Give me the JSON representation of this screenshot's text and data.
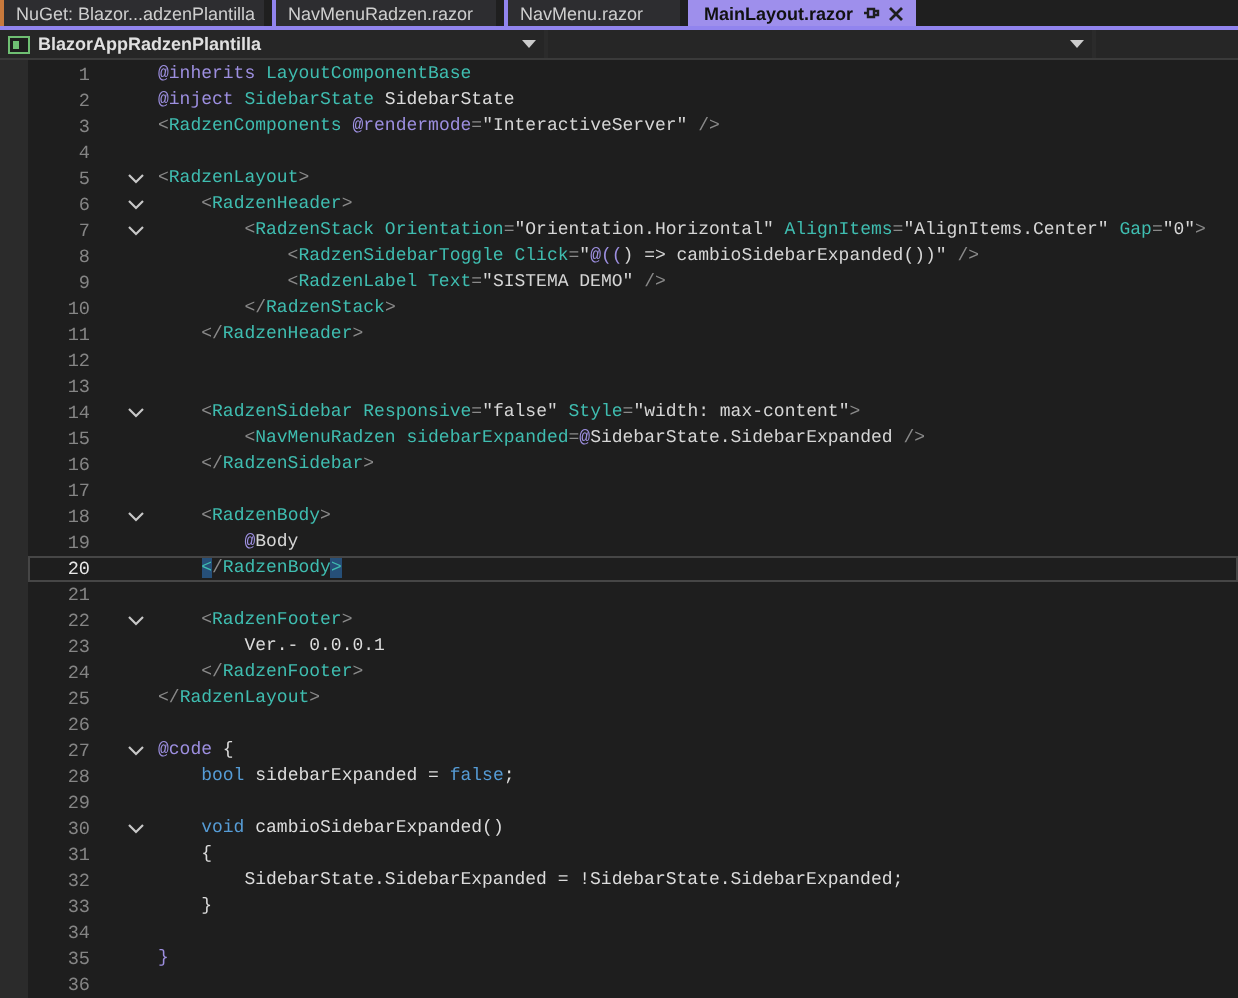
{
  "tabs": [
    {
      "label": "NuGet: Blazor...adzenPlantilla",
      "selected": false
    },
    {
      "label": "NavMenuRadzen.razor",
      "selected": false
    },
    {
      "label": "NavMenu.razor",
      "selected": false
    },
    {
      "label": "MainLayout.razor",
      "selected": true
    }
  ],
  "navigation_bar": {
    "project": "BlazorAppRadzenPlantilla"
  },
  "editor": {
    "lines": [
      {
        "number": "1",
        "fold": false,
        "current": false,
        "tokens": [
          {
            "kind": "dir",
            "t": "@inherits "
          },
          {
            "kind": "tag",
            "t": "LayoutComponentBase"
          }
        ]
      },
      {
        "number": "2",
        "fold": false,
        "current": false,
        "tokens": [
          {
            "kind": "dir",
            "t": "@inject "
          },
          {
            "kind": "tag",
            "t": "SidebarState"
          },
          {
            "kind": "plain",
            "t": " SidebarState"
          }
        ]
      },
      {
        "number": "3",
        "fold": false,
        "current": false,
        "tokens": [
          {
            "kind": "punct",
            "t": "<"
          },
          {
            "kind": "tag",
            "t": "RadzenComponents "
          },
          {
            "kind": "dir",
            "t": "@rendermode"
          },
          {
            "kind": "punct",
            "t": "="
          },
          {
            "kind": "str",
            "t": "\"InteractiveServer\""
          },
          {
            "kind": "punct",
            "t": " />"
          }
        ]
      },
      {
        "number": "4",
        "fold": false,
        "current": false
      },
      {
        "number": "5",
        "fold": true,
        "current": false,
        "tokens": [
          {
            "kind": "punct",
            "t": "<"
          },
          {
            "kind": "tag",
            "t": "RadzenLayout"
          },
          {
            "kind": "punct",
            "t": ">"
          }
        ]
      },
      {
        "number": "6",
        "fold": true,
        "current": false,
        "tokens": [
          {
            "kind": "punct",
            "t": "    <"
          },
          {
            "kind": "tag",
            "t": "RadzenHeader"
          },
          {
            "kind": "punct",
            "t": ">"
          }
        ]
      },
      {
        "number": "7",
        "fold": true,
        "current": false,
        "tokens": [
          {
            "kind": "punct",
            "t": "        <"
          },
          {
            "kind": "tag",
            "t": "RadzenStack "
          },
          {
            "kind": "attr",
            "t": "Orientation"
          },
          {
            "kind": "punct",
            "t": "="
          },
          {
            "kind": "str",
            "t": "\"Orientation.Horizontal\" "
          },
          {
            "kind": "attr",
            "t": "AlignItems"
          },
          {
            "kind": "punct",
            "t": "="
          },
          {
            "kind": "str",
            "t": "\"AlignItems.Center\" "
          },
          {
            "kind": "attr",
            "t": "Gap"
          },
          {
            "kind": "punct",
            "t": "="
          },
          {
            "kind": "str",
            "t": "\"0\""
          },
          {
            "kind": "punct",
            "t": ">"
          }
        ]
      },
      {
        "number": "8",
        "fold": false,
        "current": false,
        "tokens": [
          {
            "kind": "punct",
            "t": "            <"
          },
          {
            "kind": "tag",
            "t": "RadzenSidebarToggle "
          },
          {
            "kind": "attr",
            "t": "Click"
          },
          {
            "kind": "punct",
            "t": "="
          },
          {
            "kind": "str",
            "t": "\""
          },
          {
            "kind": "dir",
            "t": "@(("
          },
          {
            "kind": "str",
            "t": ") => cambioSidebarExpanded())\""
          },
          {
            "kind": "punct",
            "t": " />"
          }
        ]
      },
      {
        "number": "9",
        "fold": false,
        "current": false,
        "tokens": [
          {
            "kind": "punct",
            "t": "            <"
          },
          {
            "kind": "tag",
            "t": "RadzenLabel "
          },
          {
            "kind": "attr",
            "t": "Text"
          },
          {
            "kind": "punct",
            "t": "="
          },
          {
            "kind": "str",
            "t": "\"SISTEMA DEMO\""
          },
          {
            "kind": "punct",
            "t": " />"
          }
        ]
      },
      {
        "number": "10",
        "fold": false,
        "current": false,
        "tokens": [
          {
            "kind": "punct",
            "t": "        </"
          },
          {
            "kind": "tag",
            "t": "RadzenStack"
          },
          {
            "kind": "punct",
            "t": ">"
          }
        ]
      },
      {
        "number": "11",
        "fold": false,
        "current": false,
        "tokens": [
          {
            "kind": "punct",
            "t": "    </"
          },
          {
            "kind": "tag",
            "t": "RadzenHeader"
          },
          {
            "kind": "punct",
            "t": ">"
          }
        ]
      },
      {
        "number": "12",
        "fold": false,
        "current": false
      },
      {
        "number": "13",
        "fold": false,
        "current": false
      },
      {
        "number": "14",
        "fold": true,
        "current": false,
        "tokens": [
          {
            "kind": "punct",
            "t": "    <"
          },
          {
            "kind": "tag",
            "t": "RadzenSidebar "
          },
          {
            "kind": "attr",
            "t": "Responsive"
          },
          {
            "kind": "punct",
            "t": "="
          },
          {
            "kind": "str",
            "t": "\"false\" "
          },
          {
            "kind": "attr",
            "t": "Style"
          },
          {
            "kind": "punct",
            "t": "="
          },
          {
            "kind": "str",
            "t": "\"width: max-content\""
          },
          {
            "kind": "punct",
            "t": ">"
          }
        ]
      },
      {
        "number": "15",
        "fold": false,
        "current": false,
        "tokens": [
          {
            "kind": "punct",
            "t": "        <"
          },
          {
            "kind": "tag",
            "t": "NavMenuRadzen "
          },
          {
            "kind": "attr",
            "t": "sidebarExpanded"
          },
          {
            "kind": "punct",
            "t": "="
          },
          {
            "kind": "dir",
            "t": "@"
          },
          {
            "kind": "str",
            "t": "SidebarState.SidebarExpanded"
          },
          {
            "kind": "punct",
            "t": " />"
          }
        ]
      },
      {
        "number": "16",
        "fold": false,
        "current": false,
        "tokens": [
          {
            "kind": "punct",
            "t": "    </"
          },
          {
            "kind": "tag",
            "t": "RadzenSidebar"
          },
          {
            "kind": "punct",
            "t": ">"
          }
        ]
      },
      {
        "number": "17",
        "fold": false,
        "current": false
      },
      {
        "number": "18",
        "fold": true,
        "current": false,
        "tokens": [
          {
            "kind": "punct",
            "t": "    <"
          },
          {
            "kind": "tag",
            "t": "RadzenBody"
          },
          {
            "kind": "punct",
            "t": ">"
          }
        ]
      },
      {
        "number": "19",
        "fold": false,
        "current": false,
        "tokens": [
          {
            "kind": "dir",
            "t": "        @"
          },
          {
            "kind": "str",
            "t": "Body"
          }
        ]
      },
      {
        "number": "20",
        "fold": false,
        "current": true,
        "tokens": [
          {
            "kind": "match",
            "t": "    <"
          },
          {
            "kind": "punct",
            "t": "/"
          },
          {
            "kind": "tag",
            "t": "RadzenBody"
          },
          {
            "kind": "match",
            "t": ">"
          }
        ]
      },
      {
        "number": "21",
        "fold": false,
        "current": false
      },
      {
        "number": "22",
        "fold": true,
        "current": false,
        "tokens": [
          {
            "kind": "punct",
            "t": "    <"
          },
          {
            "kind": "tag",
            "t": "RadzenFooter"
          },
          {
            "kind": "punct",
            "t": ">"
          }
        ]
      },
      {
        "number": "23",
        "fold": false,
        "current": false,
        "tokens": [
          {
            "kind": "plain",
            "t": "        Ver.- 0.0.0.1"
          }
        ]
      },
      {
        "number": "24",
        "fold": false,
        "current": false,
        "tokens": [
          {
            "kind": "punct",
            "t": "    </"
          },
          {
            "kind": "tag",
            "t": "RadzenFooter"
          },
          {
            "kind": "punct",
            "t": ">"
          }
        ]
      },
      {
        "number": "25",
        "fold": false,
        "current": false,
        "tokens": [
          {
            "kind": "punct",
            "t": "</"
          },
          {
            "kind": "tag",
            "t": "RadzenLayout"
          },
          {
            "kind": "punct",
            "t": ">"
          }
        ]
      },
      {
        "number": "26",
        "fold": false,
        "current": false
      },
      {
        "number": "27",
        "fold": true,
        "current": false,
        "tokens": [
          {
            "kind": "dir",
            "t": "@code"
          },
          {
            "kind": "plain",
            "t": " {"
          }
        ]
      },
      {
        "number": "28",
        "fold": false,
        "current": false,
        "tokens": [
          {
            "kind": "kw",
            "t": "    bool"
          },
          {
            "kind": "plain",
            "t": " sidebarExpanded = "
          },
          {
            "kind": "kw",
            "t": "false"
          },
          {
            "kind": "plain",
            "t": ";"
          }
        ]
      },
      {
        "number": "29",
        "fold": false,
        "current": false
      },
      {
        "number": "30",
        "fold": true,
        "current": false,
        "tokens": [
          {
            "kind": "kw",
            "t": "    void"
          },
          {
            "kind": "plain",
            "t": " cambioSidebarExpanded()"
          }
        ]
      },
      {
        "number": "31",
        "fold": false,
        "current": false,
        "tokens": [
          {
            "kind": "plain",
            "t": "    {"
          }
        ]
      },
      {
        "number": "32",
        "fold": false,
        "current": false,
        "tokens": [
          {
            "kind": "plain",
            "t": "        SidebarState.SidebarExpanded = !SidebarState.SidebarExpanded;"
          }
        ]
      },
      {
        "number": "33",
        "fold": false,
        "current": false,
        "tokens": [
          {
            "kind": "plain",
            "t": "    }"
          }
        ]
      },
      {
        "number": "34",
        "fold": false,
        "current": false
      },
      {
        "number": "35",
        "fold": false,
        "current": false,
        "tokens": [
          {
            "kind": "dir",
            "t": "}"
          }
        ]
      },
      {
        "number": "36",
        "fold": false,
        "current": false
      }
    ]
  }
}
